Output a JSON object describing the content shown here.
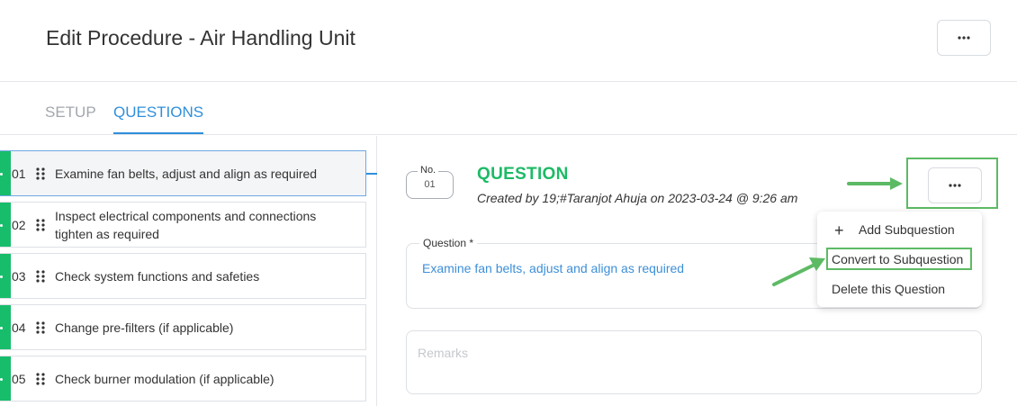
{
  "header": {
    "title": "Edit Procedure - Air Handling Unit",
    "more_icon": "ellipsis-icon"
  },
  "tabs": [
    {
      "label": "SETUP",
      "active": false
    },
    {
      "label": "QUESTIONS",
      "active": true
    }
  ],
  "questions": [
    {
      "number": "01",
      "text": "Examine fan belts, adjust and align as required",
      "selected": true
    },
    {
      "number": "02",
      "text": "Inspect electrical components and connections tighten as required",
      "selected": false
    },
    {
      "number": "03",
      "text": "Check system functions and safeties",
      "selected": false
    },
    {
      "number": "04",
      "text": "Change pre-filters (if applicable)",
      "selected": false
    },
    {
      "number": "05",
      "text": "Check burner modulation (if applicable)",
      "selected": false
    }
  ],
  "detail": {
    "no_label": "No.",
    "no_value": "01",
    "heading": "QUESTION",
    "created": "Created by 19;#Taranjot Ahuja on 2023-03-24 @ 9:26 am",
    "question_label": "Question *",
    "question_value": "Examine fan belts, adjust and align as required",
    "remarks_placeholder": "Remarks"
  },
  "menu": {
    "items": [
      {
        "label": "Add Subquestion",
        "icon": "plus-icon"
      },
      {
        "label": "Convert to Subquestion"
      },
      {
        "label": "Delete this Question"
      }
    ]
  },
  "colors": {
    "accent_blue": "#2f8fdb",
    "accent_green": "#1dba66",
    "status_bar_green": "#18bd6b",
    "annotation_green": "#5dba64"
  }
}
